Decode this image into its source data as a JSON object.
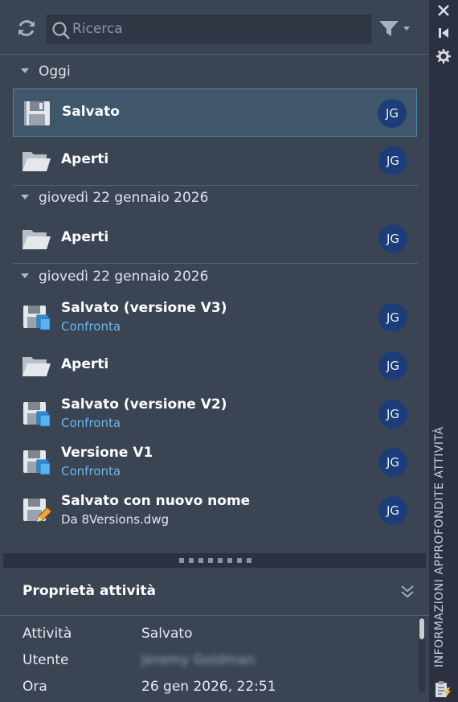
{
  "toolbar": {
    "search_placeholder": "Ricerca"
  },
  "groups": [
    {
      "label": "Oggi"
    },
    {
      "label": "giovedì 22 gennaio 2026"
    },
    {
      "label": "giovedì 22 gennaio 2026"
    }
  ],
  "activities": [
    {
      "icon": "floppy-disk-icon",
      "title": "Salvato",
      "subtitle": "",
      "user": "JG",
      "selected": true
    },
    {
      "icon": "open-folder-icon",
      "title": "Aperti",
      "subtitle": "",
      "user": "JG"
    },
    {
      "icon": "open-folder-icon",
      "title": "Aperti",
      "subtitle": "",
      "user": "JG"
    },
    {
      "icon": "floppy-disk-versions-icon",
      "title": "Salvato (versione V3)",
      "subtitle": "Confronta",
      "user": "JG"
    },
    {
      "icon": "open-folder-icon",
      "title": "Aperti",
      "subtitle": "",
      "user": "JG"
    },
    {
      "icon": "floppy-disk-versions-icon",
      "title": "Salvato (versione V2)",
      "subtitle": "Confronta",
      "user": "JG"
    },
    {
      "icon": "floppy-disk-versions-icon",
      "title": "Versione V1",
      "subtitle": "Confronta",
      "user": "JG"
    },
    {
      "icon": "floppy-disk-pencil-icon",
      "title": "Salvato con nuovo nome",
      "subtitle": "Da 8Versions.dwg",
      "user": "JG"
    }
  ],
  "properties": {
    "title": "Proprietà attività",
    "rows": [
      {
        "label": "Attività",
        "value": "Salvato"
      },
      {
        "label": "Utente",
        "value": "Jeremy Goldman"
      },
      {
        "label": "Ora",
        "value": "26 gen 2026, 22:51"
      }
    ]
  },
  "side_strip": {
    "title": "INFORMAZIONI APPROFONDITE ATTIVITÀ",
    "icons": [
      "close-icon",
      "pin-icon",
      "settings-icon",
      "clipboard-lightning-icon"
    ]
  },
  "colors": {
    "panel_bg": "#3b4453",
    "selection_bg": "#3f566b",
    "selection_border": "#4b86b1",
    "link": "#69b6ec",
    "avatar_bg": "#1d3d78"
  }
}
